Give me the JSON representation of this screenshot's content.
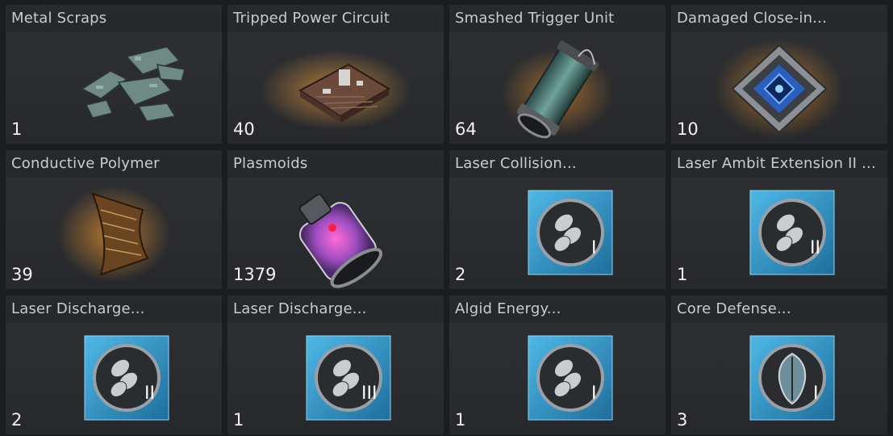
{
  "inventory": {
    "items": [
      {
        "name": "Metal Scraps",
        "count": "1",
        "icon": "metal-scraps-icon"
      },
      {
        "name": "Tripped Power Circuit",
        "count": "40",
        "icon": "circuit-board-icon"
      },
      {
        "name": "Smashed Trigger Unit",
        "count": "64",
        "icon": "trigger-canister-icon"
      },
      {
        "name": "Damaged Close-in...",
        "count": "10",
        "icon": "chip-module-icon"
      },
      {
        "name": "Conductive Polymer",
        "count": "39",
        "icon": "polymer-ribbon-icon"
      },
      {
        "name": "Plasmoids",
        "count": "1379",
        "icon": "plasma-bottle-icon"
      },
      {
        "name": "Laser Collision...",
        "count": "2",
        "icon": "laser-blueprint-icon",
        "tier": "I"
      },
      {
        "name": "Laser Ambit Extension II ...",
        "count": "1",
        "icon": "laser-blueprint-icon",
        "tier": "II"
      },
      {
        "name": "Laser Discharge...",
        "count": "2",
        "icon": "laser-blueprint-icon",
        "tier": "II"
      },
      {
        "name": "Laser Discharge...",
        "count": "1",
        "icon": "laser-blueprint-icon",
        "tier": "III"
      },
      {
        "name": "Algid Energy...",
        "count": "1",
        "icon": "laser-blueprint-icon",
        "tier": "I"
      },
      {
        "name": "Core Defense...",
        "count": "3",
        "icon": "shield-blueprint-icon",
        "tier": "I"
      }
    ]
  },
  "colors": {
    "accent_blue": "#3aa8d8",
    "glow_orange": "#e8922f",
    "text": "#c9cbcd"
  }
}
